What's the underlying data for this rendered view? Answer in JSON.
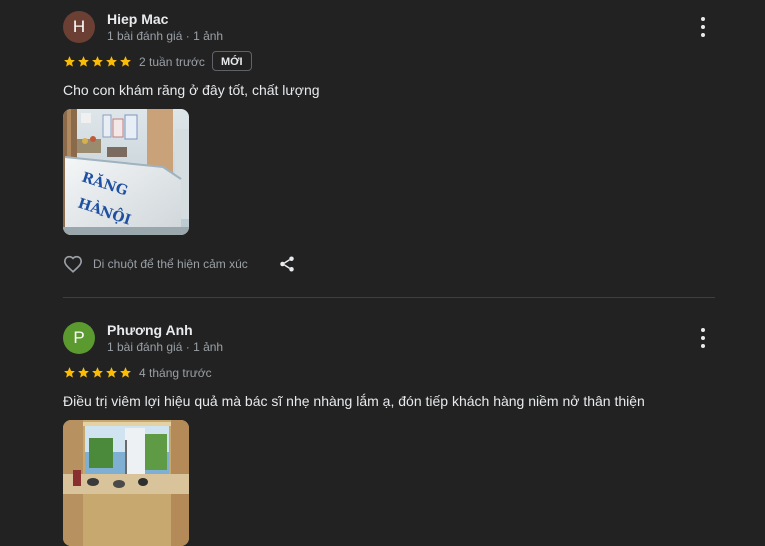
{
  "reviews": [
    {
      "avatar_letter": "H",
      "avatar_color": "#6b3f33",
      "name": "Hiep Mac",
      "meta": "1 bài đánh giá · 1 ảnh",
      "rating": 5,
      "time": "2 tuần trước",
      "badge": "MỚI",
      "text": "Cho con khám răng ở đây tốt, chất lượng",
      "photo_icon": "clinic-reception-photo",
      "photo_sign_text": "RĂNG HÀ NỘI",
      "react_label": "Di chuột để thể hiện cảm xúc"
    },
    {
      "avatar_letter": "P",
      "avatar_color": "#5a9a2e",
      "name": "Phương Anh",
      "meta": "1 bài đánh giá · 1 ảnh",
      "rating": 5,
      "time": "4 tháng trước",
      "text": "Điều trị viêm lợi hiệu quả mà bác sĩ nhẹ nhàng lắm ạ, đón tiếp khách hàng niềm nở thân thiện",
      "photo_icon": "clinic-entrance-photo"
    }
  ],
  "colors": {
    "background": "#222222",
    "star": "#fbbc04",
    "text_primary": "#e8eaed",
    "text_secondary": "#9aa0a6",
    "divider": "#3c4043"
  }
}
